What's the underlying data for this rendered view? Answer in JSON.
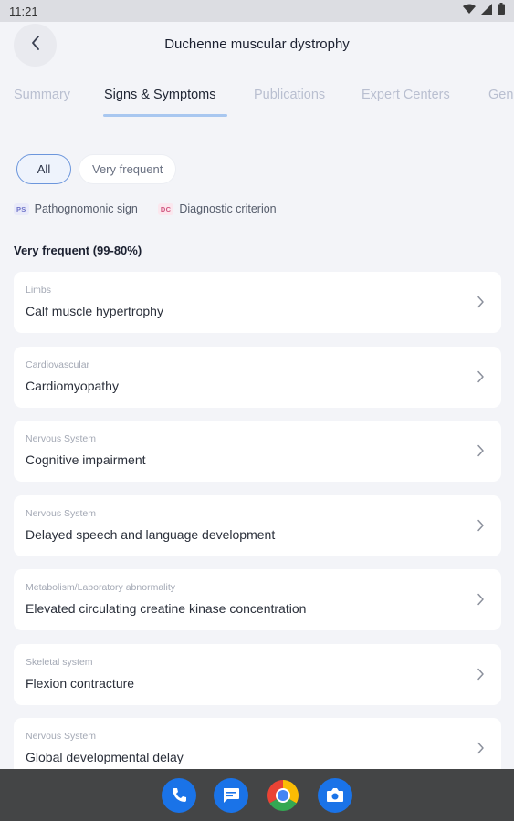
{
  "status_bar": {
    "time": "11:21"
  },
  "header": {
    "title": "Duchenne muscular dystrophy"
  },
  "tabs": [
    {
      "label": "Summary"
    },
    {
      "label": "Signs & Symptoms"
    },
    {
      "label": "Publications"
    },
    {
      "label": "Expert Centers"
    },
    {
      "label": "Gen"
    }
  ],
  "active_tab": "Signs & Symptoms",
  "filters": {
    "all_label": "All",
    "very_frequent_label": "Very frequent",
    "selected": "All"
  },
  "legend": {
    "ps_badge": "PS",
    "ps_label": "Pathognomonic sign",
    "dc_badge": "DC",
    "dc_label": "Diagnostic criterion"
  },
  "section": {
    "title": "Very frequent (99-80%)"
  },
  "symptoms": [
    {
      "category": "Limbs",
      "label": "Calf muscle hypertrophy"
    },
    {
      "category": "Cardiovascular",
      "label": "Cardiomyopathy"
    },
    {
      "category": "Nervous System",
      "label": "Cognitive impairment"
    },
    {
      "category": "Nervous System",
      "label": "Delayed speech and language development"
    },
    {
      "category": "Metabolism/Laboratory abnormality",
      "label": "Elevated circulating creatine kinase concentration"
    },
    {
      "category": "Skeletal system",
      "label": "Flexion contracture"
    },
    {
      "category": "Nervous System",
      "label": "Global developmental delay"
    }
  ],
  "dock": [
    {
      "icon": "phone-icon",
      "color": "#1a73e8"
    },
    {
      "icon": "messages-icon",
      "color": "#1a73e8"
    },
    {
      "icon": "chrome-icon",
      "color": "#ea4335"
    },
    {
      "icon": "camera-icon",
      "color": "#1a73e8"
    }
  ],
  "colors": {
    "accent": "#6c96dc",
    "background": "#f3f4f8",
    "tab_inactive": "#b9bfd0"
  }
}
